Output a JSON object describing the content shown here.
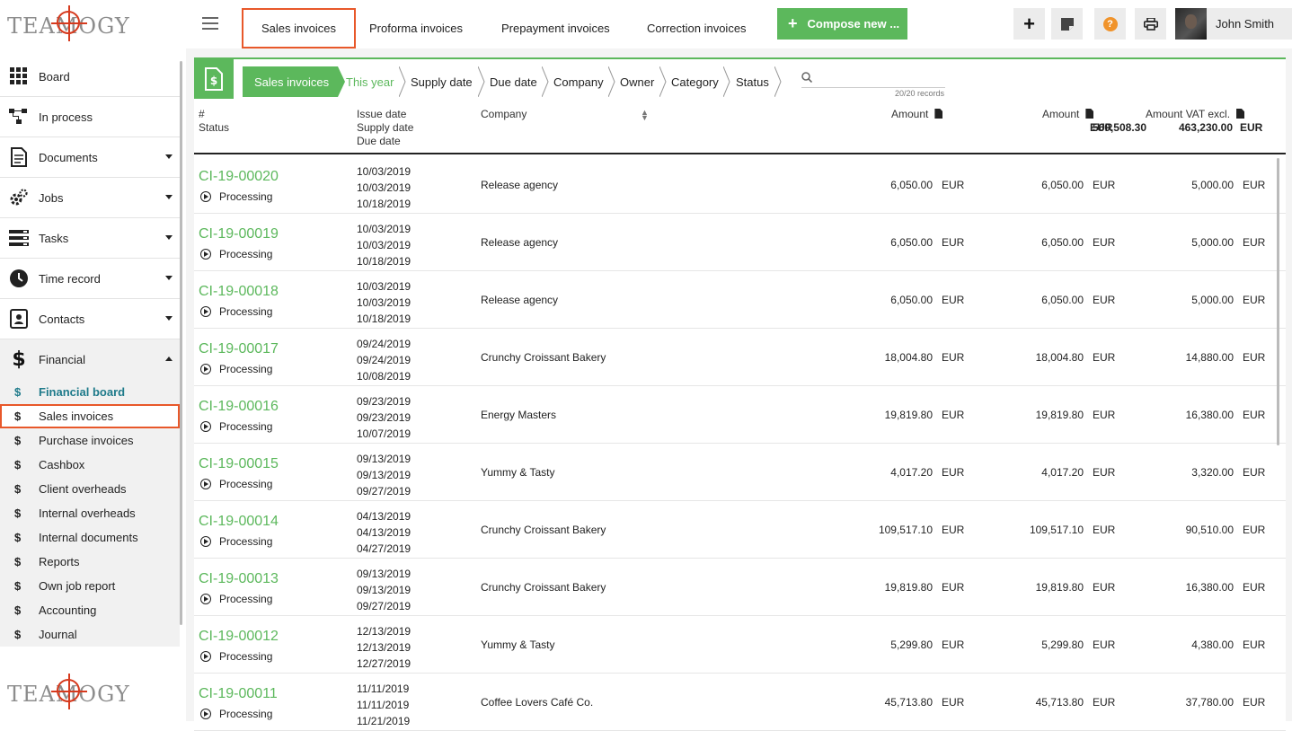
{
  "app": {
    "logo_text": "TEAMOGY"
  },
  "sidebar": {
    "items": [
      {
        "label": "Board",
        "icon": "grid-icon",
        "caret": false
      },
      {
        "label": "In process",
        "icon": "flow-icon",
        "caret": false
      },
      {
        "label": "Documents",
        "icon": "document-icon",
        "caret": true
      },
      {
        "label": "Jobs",
        "icon": "gears-icon",
        "caret": true
      },
      {
        "label": "Tasks",
        "icon": "tasks-icon",
        "caret": true
      },
      {
        "label": "Time record",
        "icon": "clock-icon",
        "caret": true
      },
      {
        "label": "Contacts",
        "icon": "contact-card-icon",
        "caret": true
      },
      {
        "label": "Financial",
        "icon": "dollar-icon",
        "caret": true,
        "expanded": true
      }
    ],
    "financial_sub": [
      {
        "label": "Financial board",
        "active": true
      },
      {
        "label": "Sales invoices",
        "selected": true
      },
      {
        "label": "Purchase invoices"
      },
      {
        "label": "Cashbox"
      },
      {
        "label": "Client overheads"
      },
      {
        "label": "Internal overheads"
      },
      {
        "label": "Internal documents"
      },
      {
        "label": "Reports"
      },
      {
        "label": "Own job report"
      },
      {
        "label": "Accounting"
      },
      {
        "label": "Journal"
      }
    ]
  },
  "topbar": {
    "tabs": [
      "Sales invoices",
      "Proforma invoices",
      "Prepayment invoices",
      "Correction invoices"
    ],
    "compose_label": "Compose new ...",
    "user_name": "John Smith"
  },
  "filters": {
    "crumbs": [
      "Sales invoices",
      "This year",
      "Supply date",
      "Due date",
      "Company",
      "Owner",
      "Category",
      "Status"
    ],
    "records": "20/20 records"
  },
  "table": {
    "headers": {
      "id": "#",
      "status": "Status",
      "issue": "Issue date",
      "supply": "Supply date",
      "due": "Due date",
      "company": "Company",
      "amount": "Amount",
      "amount2": "Amount",
      "amount2_total": "560,508.30",
      "amount2_cur": "EUR",
      "vat": "Amount VAT excl.",
      "vat_total": "463,230.00",
      "vat_cur": "EUR"
    },
    "rows": [
      {
        "id": "CI-19-00020",
        "status": "Processing",
        "issue": "10/03/2019",
        "supply": "10/03/2019",
        "due": "10/18/2019",
        "company": "Release agency",
        "amount": "6,050.00",
        "amount_cur": "EUR",
        "amount2": "6,050.00",
        "amount2_cur": "EUR",
        "vat": "5,000.00",
        "vat_cur": "EUR"
      },
      {
        "id": "CI-19-00019",
        "status": "Processing",
        "issue": "10/03/2019",
        "supply": "10/03/2019",
        "due": "10/18/2019",
        "company": "Release agency",
        "amount": "6,050.00",
        "amount_cur": "EUR",
        "amount2": "6,050.00",
        "amount2_cur": "EUR",
        "vat": "5,000.00",
        "vat_cur": "EUR"
      },
      {
        "id": "CI-19-00018",
        "status": "Processing",
        "issue": "10/03/2019",
        "supply": "10/03/2019",
        "due": "10/18/2019",
        "company": "Release agency",
        "amount": "6,050.00",
        "amount_cur": "EUR",
        "amount2": "6,050.00",
        "amount2_cur": "EUR",
        "vat": "5,000.00",
        "vat_cur": "EUR"
      },
      {
        "id": "CI-19-00017",
        "status": "Processing",
        "issue": "09/24/2019",
        "supply": "09/24/2019",
        "due": "10/08/2019",
        "company": "Crunchy Croissant Bakery",
        "amount": "18,004.80",
        "amount_cur": "EUR",
        "amount2": "18,004.80",
        "amount2_cur": "EUR",
        "vat": "14,880.00",
        "vat_cur": "EUR"
      },
      {
        "id": "CI-19-00016",
        "status": "Processing",
        "issue": "09/23/2019",
        "supply": "09/23/2019",
        "due": "10/07/2019",
        "company": "Energy Masters",
        "amount": "19,819.80",
        "amount_cur": "EUR",
        "amount2": "19,819.80",
        "amount2_cur": "EUR",
        "vat": "16,380.00",
        "vat_cur": "EUR"
      },
      {
        "id": "CI-19-00015",
        "status": "Processing",
        "issue": "09/13/2019",
        "supply": "09/13/2019",
        "due": "09/27/2019",
        "company": "Yummy & Tasty",
        "amount": "4,017.20",
        "amount_cur": "EUR",
        "amount2": "4,017.20",
        "amount2_cur": "EUR",
        "vat": "3,320.00",
        "vat_cur": "EUR"
      },
      {
        "id": "CI-19-00014",
        "status": "Processing",
        "issue": "04/13/2019",
        "supply": "04/13/2019",
        "due": "04/27/2019",
        "company": "Crunchy Croissant Bakery",
        "amount": "109,517.10",
        "amount_cur": "EUR",
        "amount2": "109,517.10",
        "amount2_cur": "EUR",
        "vat": "90,510.00",
        "vat_cur": "EUR"
      },
      {
        "id": "CI-19-00013",
        "status": "Processing",
        "issue": "09/13/2019",
        "supply": "09/13/2019",
        "due": "09/27/2019",
        "company": "Crunchy Croissant Bakery",
        "amount": "19,819.80",
        "amount_cur": "EUR",
        "amount2": "19,819.80",
        "amount2_cur": "EUR",
        "vat": "16,380.00",
        "vat_cur": "EUR"
      },
      {
        "id": "CI-19-00012",
        "status": "Processing",
        "issue": "12/13/2019",
        "supply": "12/13/2019",
        "due": "12/27/2019",
        "company": "Yummy & Tasty",
        "amount": "5,299.80",
        "amount_cur": "EUR",
        "amount2": "5,299.80",
        "amount2_cur": "EUR",
        "vat": "4,380.00",
        "vat_cur": "EUR"
      },
      {
        "id": "CI-19-00011",
        "status": "Processing",
        "issue": "11/11/2019",
        "supply": "11/11/2019",
        "due": "11/21/2019",
        "company": "Coffee Lovers Café Co.",
        "amount": "45,713.80",
        "amount_cur": "EUR",
        "amount2": "45,713.80",
        "amount2_cur": "EUR",
        "vat": "37,780.00",
        "vat_cur": "EUR"
      }
    ]
  }
}
